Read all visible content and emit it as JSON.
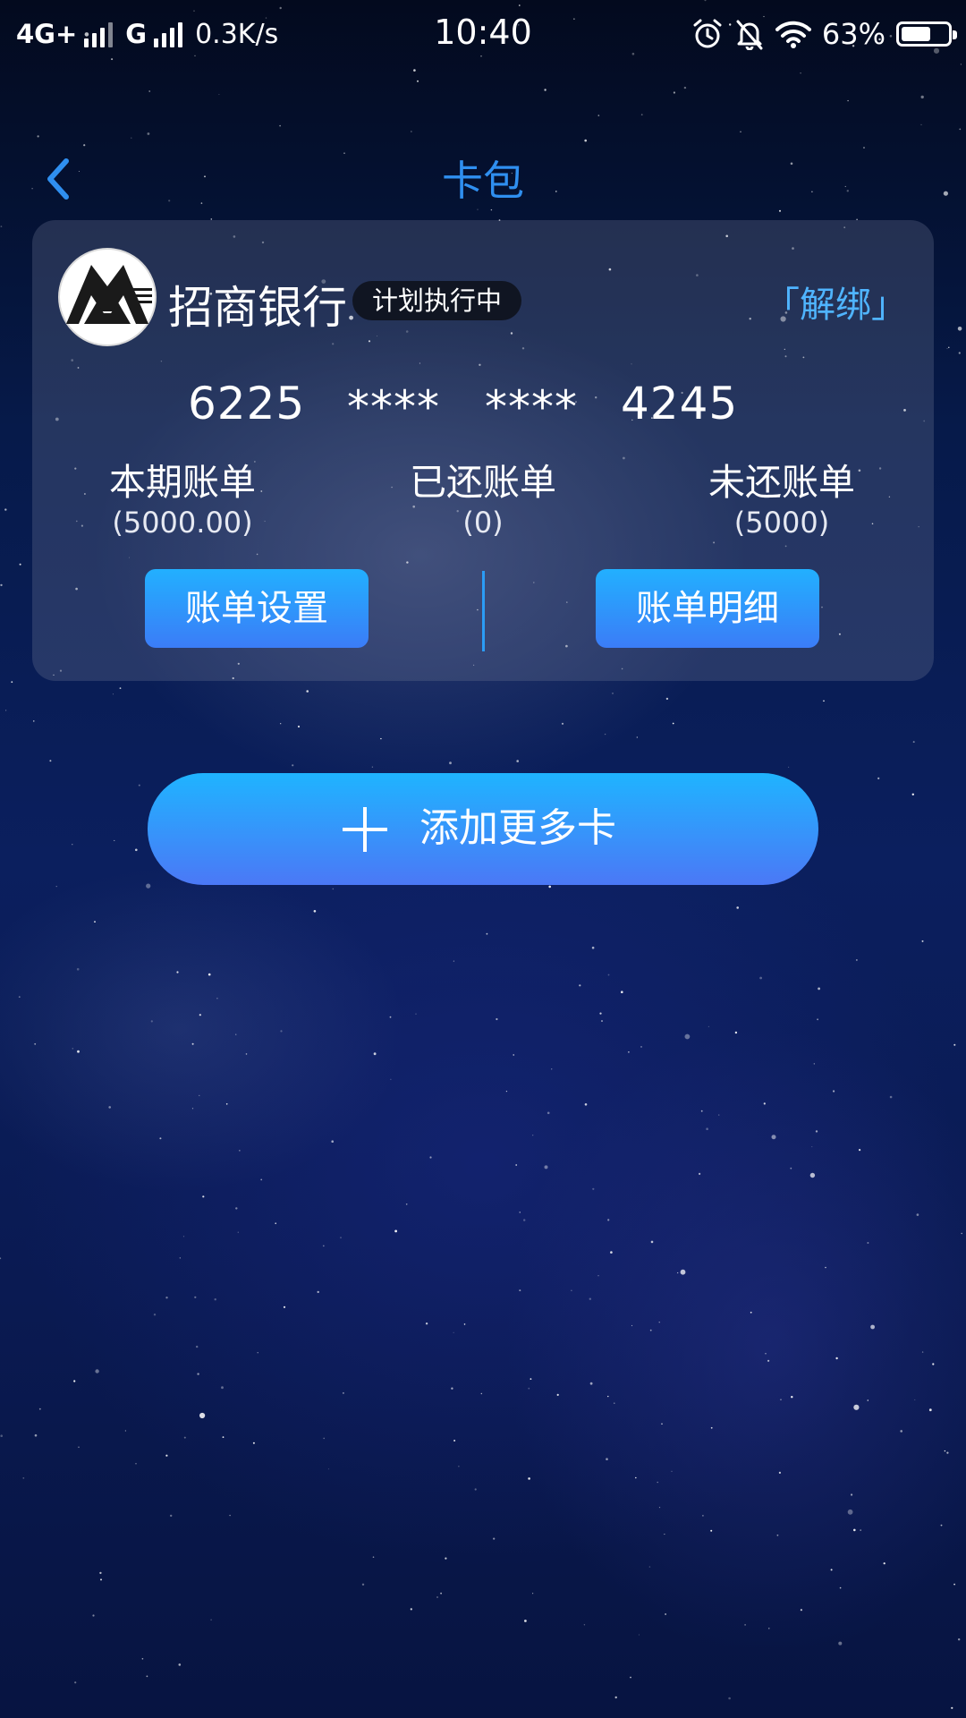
{
  "status_bar": {
    "network_1": "4G+",
    "network_2": "G",
    "speed": "0.3K/s",
    "time": "10:40",
    "battery_text": "63%",
    "battery_level": 0.63,
    "icons": [
      "alarm-icon",
      "bell-off-icon",
      "wifi-icon",
      "battery-icon"
    ]
  },
  "header": {
    "title": "卡包",
    "back_icon": "chevron-left-icon"
  },
  "card": {
    "bank_name": "招商银行",
    "bank_logo": "cmb-logo",
    "badge": "计划执行中",
    "unbind": "「解绑」",
    "number_groups": [
      "6225",
      "****",
      "****",
      "4245"
    ],
    "stats": [
      {
        "label": "本期账单",
        "value": "(5000.00)"
      },
      {
        "label": "已还账单",
        "value": "(0)"
      },
      {
        "label": "未还账单",
        "value": "(5000)"
      }
    ],
    "buttons": {
      "bill_settings": "账单设置",
      "bill_details": "账单明细"
    }
  },
  "add_card": {
    "label": "添加更多卡",
    "icon": "plus-icon"
  },
  "colors": {
    "accent": "#2f8ff0",
    "link": "#4fb4ff",
    "button_top": "#22b0ff",
    "button_bottom": "#3b7cf7"
  }
}
